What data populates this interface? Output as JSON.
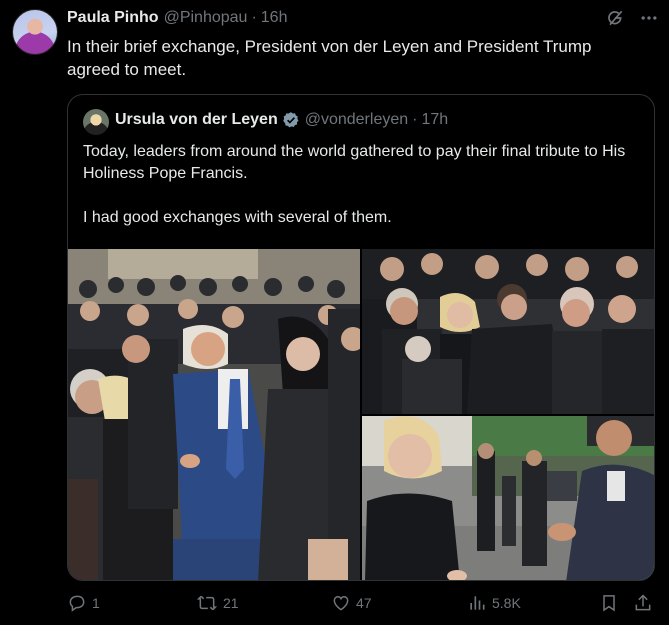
{
  "tweet": {
    "author_name": "Paula Pinho",
    "handle": "@Pinhopau",
    "separator": "·",
    "time": "16h",
    "text": "In their brief exchange, President von der Leyen and President Trump agreed to meet."
  },
  "quote": {
    "author_name": "Ursula von der Leyen",
    "handle": "@vonderleyen",
    "separator": "·",
    "time": "17h",
    "paragraph1": "Today, leaders from around the world gathered to pay their final tribute to His Holiness Pope Francis.",
    "paragraph2": "I had good exchanges with several of them.",
    "verified_color": "#829aab"
  },
  "actions": {
    "reply_count": "1",
    "retweet_count": "21",
    "like_count": "47",
    "views_count": "5.8K"
  },
  "icons": {
    "grok": "grok-icon",
    "more": "more-icon",
    "reply": "reply-icon",
    "retweet": "retweet-icon",
    "like": "like-icon",
    "views": "views-icon",
    "bookmark": "bookmark-icon",
    "share": "share-icon"
  },
  "colors": {
    "background": "#000000",
    "text": "#e7e9ea",
    "muted": "#71767b",
    "border": "#2f3336"
  }
}
